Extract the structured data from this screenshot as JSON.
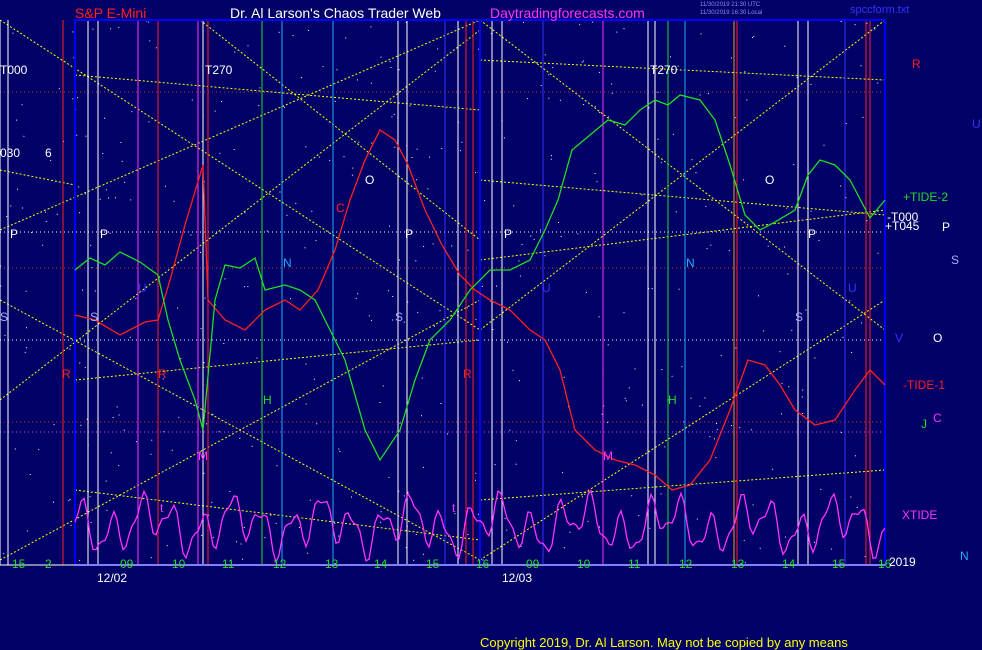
{
  "header": {
    "instrument": "S&P E-Mini",
    "author": "Dr. Al Larson's Chaos Trader Web",
    "site": "Daytradingforecasts.com",
    "filename": "spccform.txt",
    "stamp1": "11/30/2019 21:30 UTC",
    "stamp2": "11/30/2019 16:30 Local"
  },
  "footer": {
    "copyright": "Copyright 2019, Dr. Al Larson. May not be copied by any means",
    "year": "2019"
  },
  "colors": {
    "background": "#000066",
    "price": "#ff2020",
    "tide1": "#ff2020",
    "tide2": "#22dd22",
    "xtide": "#ff33ff",
    "flux": "#ffff00",
    "frame": "#0000ff"
  },
  "chart_data": {
    "type": "line",
    "x_tick_labels": [
      "15",
      "2",
      "09",
      "10",
      "11",
      "12",
      "13",
      "14",
      "15",
      "16",
      "09",
      "10",
      "11",
      "12",
      "13",
      "14",
      "15",
      "16"
    ],
    "date_labels": [
      "12/02",
      "12/03"
    ],
    "grid": true,
    "series": [
      {
        "name": "-TIDE-1",
        "color": "#ff2020"
      },
      {
        "name": "+TIDE-2",
        "color": "#22dd22"
      },
      {
        "name": "XTIDE",
        "color": "#ff33ff"
      }
    ],
    "right_labels": [
      {
        "text": "R",
        "color": "#ff2020"
      },
      {
        "text": "U",
        "color": "#3333ff"
      },
      {
        "text": "+TIDE-2",
        "color": "#22dd22"
      },
      {
        "text": "-T000",
        "color": "#ffffff"
      },
      {
        "text": "+T045",
        "color": "#ffffff"
      },
      {
        "text": "P",
        "color": "#ffffff"
      },
      {
        "text": "S",
        "color": "#aaaaff"
      },
      {
        "text": "V",
        "color": "#3333ff"
      },
      {
        "text": "O",
        "color": "#ffffff"
      },
      {
        "text": "-TIDE-1",
        "color": "#ff2020"
      },
      {
        "text": "C",
        "color": "#ff33ff"
      },
      {
        "text": "J",
        "color": "#22dd22"
      },
      {
        "text": "XTIDE",
        "color": "#ff33ff"
      },
      {
        "text": "N",
        "color": "#22aaff"
      }
    ],
    "line_labels": [
      {
        "text": "T000",
        "color": "#ffffff"
      },
      {
        "text": "T270",
        "color": "#ffffff"
      },
      {
        "text": "T270",
        "color": "#ffffff"
      },
      {
        "text": "030",
        "color": "#ffffff"
      },
      {
        "text": "6",
        "color": "#ffffff"
      },
      {
        "text": "P",
        "color": "#ffffff"
      },
      {
        "text": "P",
        "color": "#ffffff"
      },
      {
        "text": "P",
        "color": "#ffffff"
      },
      {
        "text": "P",
        "color": "#ffffff"
      },
      {
        "text": "P",
        "color": "#ffffff"
      },
      {
        "text": "S",
        "color": "#aaaaff"
      },
      {
        "text": "S",
        "color": "#aaaaff"
      },
      {
        "text": "S",
        "color": "#aaaaff"
      },
      {
        "text": "S",
        "color": "#aaaaff"
      },
      {
        "text": "O",
        "color": "#ffffff"
      },
      {
        "text": "O",
        "color": "#ffffff"
      },
      {
        "text": "C",
        "color": "#ff2020"
      },
      {
        "text": "N",
        "color": "#22aaff"
      },
      {
        "text": "N",
        "color": "#22aaff"
      },
      {
        "text": "U",
        "color": "#3333ff"
      },
      {
        "text": "U",
        "color": "#3333ff"
      },
      {
        "text": "U",
        "color": "#3333ff"
      },
      {
        "text": "H",
        "color": "#22dd22"
      },
      {
        "text": "H",
        "color": "#22dd22"
      },
      {
        "text": "M",
        "color": "#ff33ff"
      },
      {
        "text": "M",
        "color": "#ff33ff"
      },
      {
        "text": "R",
        "color": "#ff2020"
      },
      {
        "text": "R",
        "color": "#ff2020"
      },
      {
        "text": "R",
        "color": "#ff2020"
      },
      {
        "text": "t",
        "color": "#ff33ff"
      },
      {
        "text": "t",
        "color": "#ff33ff"
      }
    ]
  }
}
